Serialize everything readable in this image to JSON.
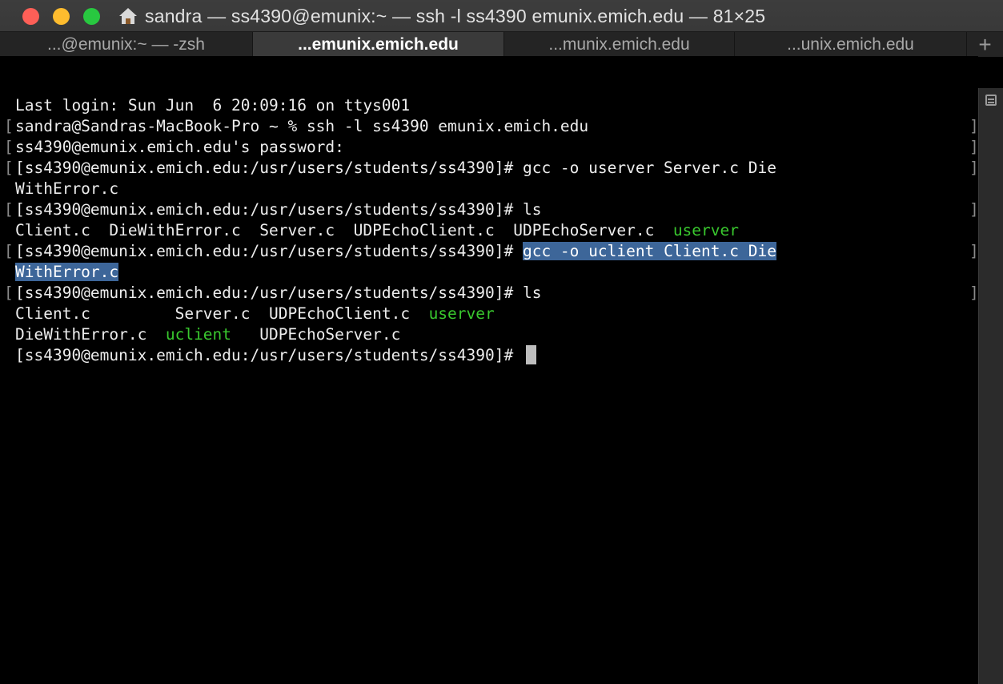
{
  "window": {
    "title": "sandra — ss4390@emunix:~ — ssh -l ss4390 emunix.emich.edu — 81×25"
  },
  "tabs": [
    {
      "label": "...@emunix:~ — -zsh",
      "active": false
    },
    {
      "label": "...emunix.emich.edu",
      "active": true
    },
    {
      "label": "...munix.emich.edu",
      "active": false
    },
    {
      "label": "...unix.emich.edu",
      "active": false
    }
  ],
  "new_tab_label": "+",
  "terminal": {
    "line1": "Last login: Sun Jun  6 20:09:16 on ttys001",
    "line2": "sandra@Sandras-MacBook-Pro ~ % ssh -l ss4390 emunix.emich.edu",
    "line3": "ss4390@emunix.emich.edu's password:",
    "line4": "[ss4390@emunix.emich.edu:/usr/users/students/ss4390]# gcc -o userver Server.c Die",
    "line5": "WithError.c",
    "line6": "[ss4390@emunix.emich.edu:/usr/users/students/ss4390]# ls",
    "line7_text": "Client.c  DieWithError.c  Server.c  UDPEchoClient.c  UDPEchoServer.c  ",
    "line7_exec": "userver",
    "line8_prompt": "[ss4390@emunix.emich.edu:/usr/users/students/ss4390]# ",
    "line8_selected": "gcc -o uclient Client.c Die",
    "line9_selected": "WithError.c",
    "line10": "[ss4390@emunix.emich.edu:/usr/users/students/ss4390]# ls",
    "line11_text": "Client.c         Server.c  UDPEchoClient.c  ",
    "line11_exec": "userver",
    "line12_text": "DieWithError.c  ",
    "line12_exec": "uclient",
    "line12_rest": "   UDPEchoServer.c",
    "line13": "[ss4390@emunix.emich.edu:/usr/users/students/ss4390]# ",
    "left_marker": "[",
    "right_marker": "]"
  },
  "colors": {
    "executable": "#39c82e",
    "selection": "#3d6699"
  }
}
